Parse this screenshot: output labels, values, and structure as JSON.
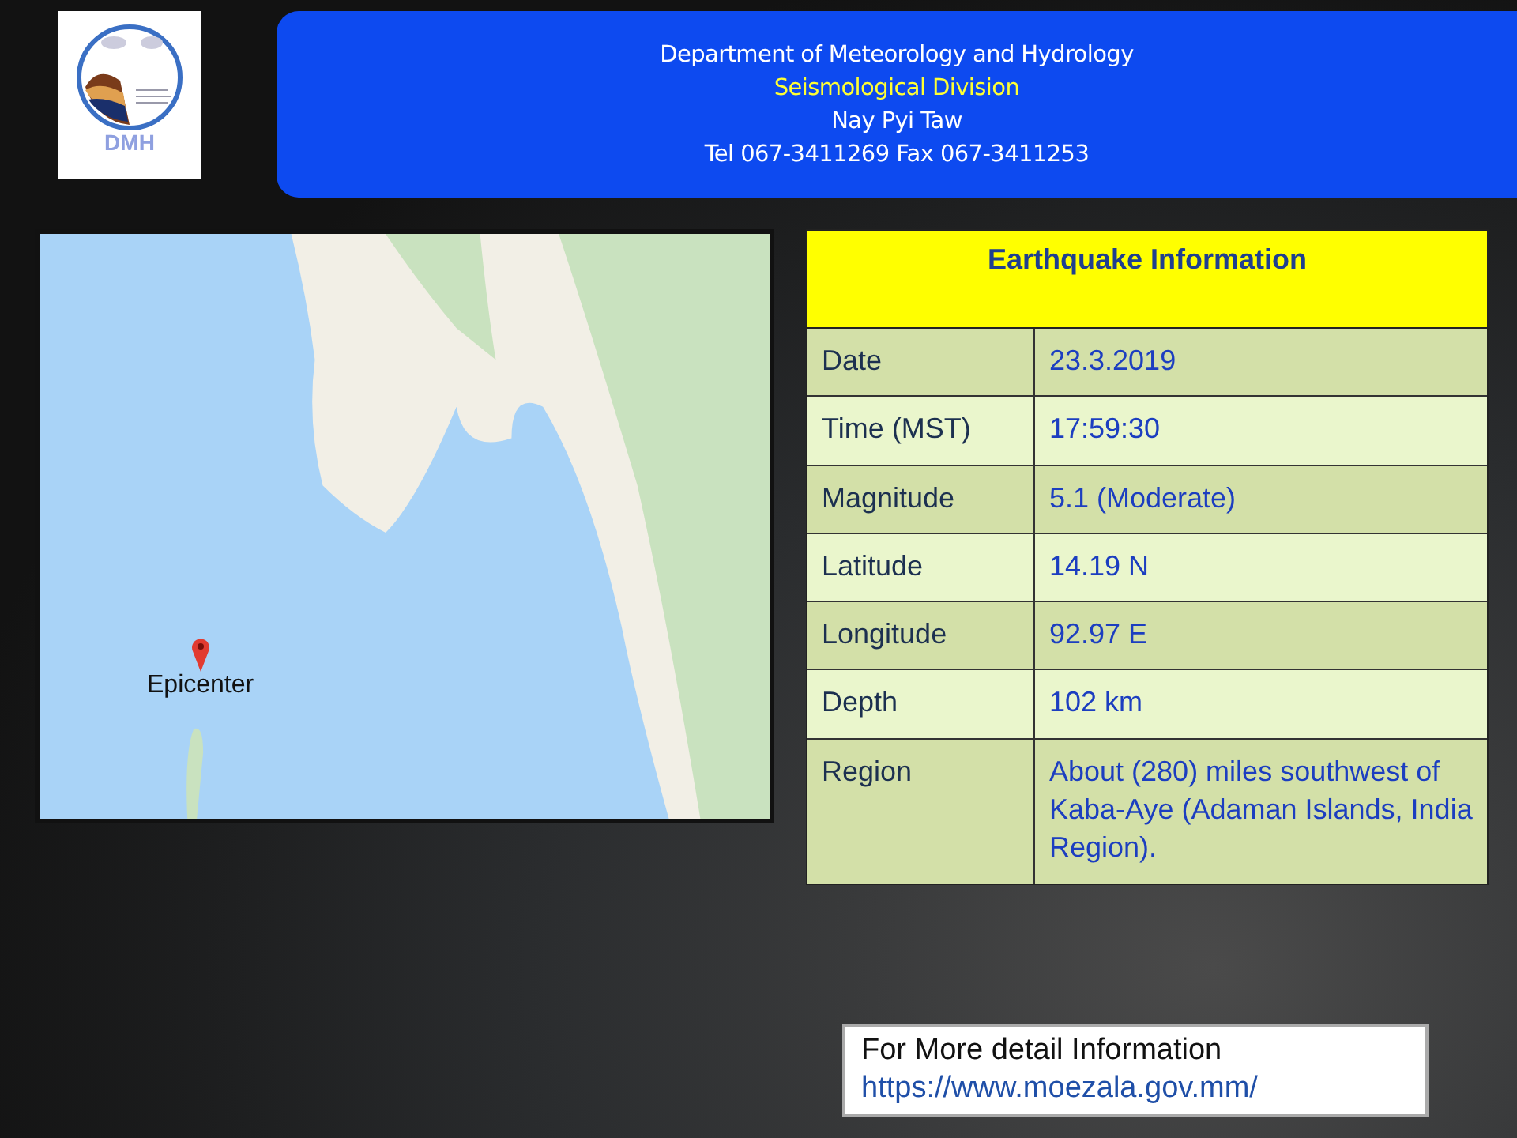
{
  "logo": {
    "text": "DMH"
  },
  "header": {
    "lines": [
      {
        "text": "Department of Meteorology and Hydrology",
        "kind": "title"
      },
      {
        "text": "Seismological Division",
        "kind": "highlight"
      },
      {
        "text": "Nay Pyi Taw",
        "kind": "title"
      },
      {
        "text": "Tel 067-3411269 Fax 067-3411253",
        "kind": "title"
      }
    ]
  },
  "map": {
    "marker_label": "Epicenter"
  },
  "table": {
    "title": "Earthquake Information",
    "rows": [
      {
        "label": "Date",
        "value": "23.3.2019"
      },
      {
        "label": "Time (MST)",
        "value": "17:59:30"
      },
      {
        "label": "Magnitude",
        "value": "5.1 (Moderate)"
      },
      {
        "label": "Latitude",
        "value": "14.19 N"
      },
      {
        "label": "Longitude",
        "value": "92.97 E"
      },
      {
        "label": "Depth",
        "value": "102 km"
      },
      {
        "label": "Region",
        "value": "About (280) miles southwest of  Kaba-Aye (Adaman Islands, India Region)."
      }
    ]
  },
  "footer": {
    "text": "For More detail Information",
    "link": "https://www.moezala.gov.mm/"
  }
}
